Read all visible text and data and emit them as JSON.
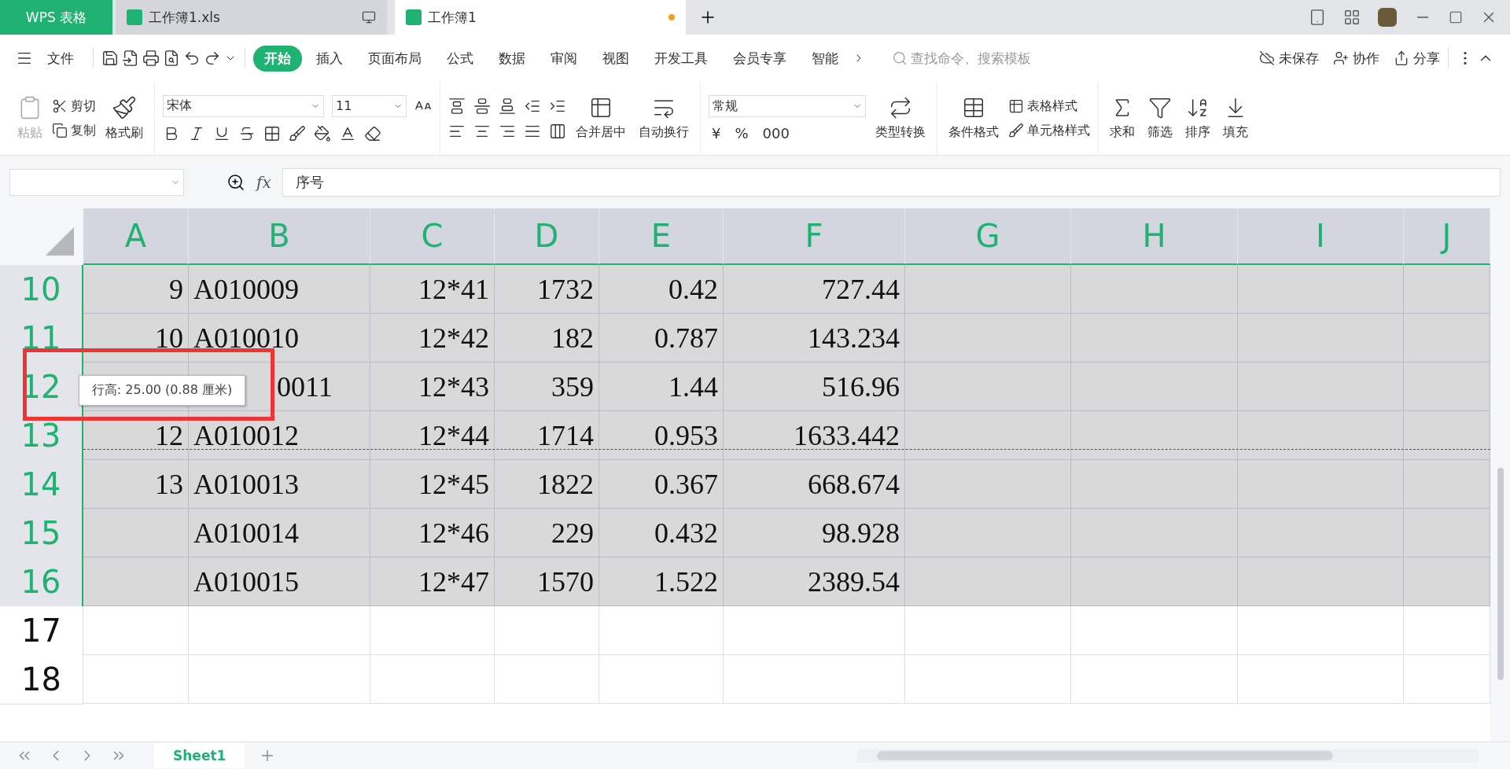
{
  "title_bar": {
    "app_tab": "WPS 表格",
    "doc_tabs": [
      {
        "label": "工作簿1.xls",
        "selected": false,
        "unsaved": false
      },
      {
        "label": "工作簿1",
        "selected": true,
        "unsaved": true
      }
    ]
  },
  "menu": {
    "file": "文件",
    "tabs": [
      {
        "label": "开始",
        "selected": true
      },
      {
        "label": "插入",
        "selected": false
      },
      {
        "label": "页面布局",
        "selected": false
      },
      {
        "label": "公式",
        "selected": false
      },
      {
        "label": "数据",
        "selected": false
      },
      {
        "label": "审阅",
        "selected": false
      },
      {
        "label": "视图",
        "selected": false
      },
      {
        "label": "开发工具",
        "selected": false
      },
      {
        "label": "会员专享",
        "selected": false
      },
      {
        "label": "智能",
        "selected": false
      }
    ],
    "search_placeholder": "查找命令、搜索模板",
    "actions": [
      "未保存",
      "协作",
      "分享"
    ]
  },
  "ribbon": {
    "paste": {
      "label": "粘贴",
      "disabled": true
    },
    "cut": "剪切",
    "copy": "复制",
    "format_painter": "格式刷",
    "font": "宋体",
    "font_size": "11",
    "merge": "合并居中",
    "wrap": "自动换行",
    "number_format": "常规",
    "currency": "¥",
    "percent": "%",
    "thousands": "000",
    "convert": "类型转换",
    "conditional": "条件格式",
    "table_style": "表格样式",
    "cell_style": "单元格样式",
    "sum": "求和",
    "filter": "筛选",
    "sort": "排序",
    "fill": "填充"
  },
  "formula_bar": {
    "fx": "fx",
    "content": "序号"
  },
  "columns": [
    "A",
    "B",
    "C",
    "D",
    "E",
    "F",
    "G",
    "H",
    "I",
    "J"
  ],
  "rows": [
    {
      "header": "10",
      "selected": true,
      "cells": [
        "9",
        "A010009",
        "12*41",
        "1732",
        "0.42",
        "727.44"
      ]
    },
    {
      "header": "11",
      "selected": true,
      "cells": [
        "10",
        "A010010",
        "12*42",
        "182",
        "0.787",
        "143.234"
      ]
    },
    {
      "header": "12",
      "selected": true,
      "cells": [
        "",
        "0011",
        "12*43",
        "359",
        "1.44",
        "516.96"
      ]
    },
    {
      "header": "13",
      "selected": true,
      "cells": [
        "12",
        "A010012",
        "12*44",
        "1714",
        "0.953",
        "1633.442"
      ]
    },
    {
      "header": "14",
      "selected": true,
      "cells": [
        "13",
        "A010013",
        "12*45",
        "1822",
        "0.367",
        "668.674"
      ]
    },
    {
      "header": "15",
      "selected": true,
      "cells": [
        "",
        "A010014",
        "12*46",
        "229",
        "0.432",
        "98.928"
      ]
    },
    {
      "header": "16",
      "selected": true,
      "cells": [
        "",
        "A010015",
        "12*47",
        "1570",
        "1.522",
        "2389.54"
      ]
    },
    {
      "header": "17",
      "selected": false,
      "cells": []
    },
    {
      "header": "18",
      "selected": false,
      "cells": []
    }
  ],
  "tooltip": "行高: 25.00 (0.88 厘米)",
  "sheets": [
    {
      "label": "Sheet1",
      "selected": true
    }
  ]
}
